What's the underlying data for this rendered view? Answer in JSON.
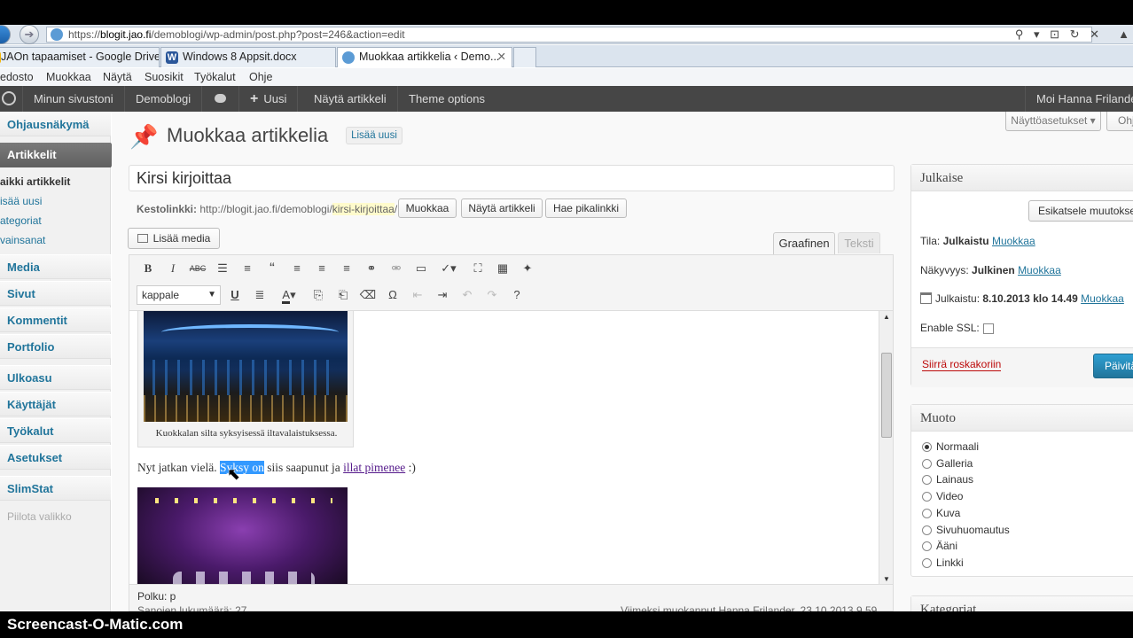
{
  "browser": {
    "url_prefix": "https://",
    "url_host": "blogit.jao.fi",
    "url_path": "/demoblogi/wp-admin/post.php?post=246&action=edit",
    "tabs": [
      {
        "label": "JAOn tapaamiset - Google Drive",
        "icon_color": "#f4b400"
      },
      {
        "label": "Windows 8 Appsit.docx",
        "icon_color": "#2b579a"
      },
      {
        "label": "Muokkaa artikkelia ‹ Demo...",
        "icon_color": "#5b9bd5"
      }
    ],
    "menu": [
      "edosto",
      "Muokkaa",
      "Näytä",
      "Suosikit",
      "Työkalut",
      "Ohje"
    ]
  },
  "adminbar": {
    "items": [
      "Minun sivustoni",
      "Demoblogi",
      "Uusi",
      "Näytä artikkeli",
      "Theme options"
    ],
    "plus": "+",
    "greeting": "Moi Hanna Frilande"
  },
  "sidebar": {
    "dashboard": "Ohjausnäkymä",
    "posts": "Artikkelit",
    "submenu": [
      "Kaikki artikkelit",
      "Lisää uusi",
      "Kategoriat",
      "Avainsanat"
    ],
    "submenu_visible": [
      "aikki artikkelit",
      "isää uusi",
      "ategoriat",
      "vainsanat"
    ],
    "menus": [
      "Media",
      "Sivut",
      "Kommentit",
      "Portfolio",
      "Ulkoasu",
      "Käyttäjät",
      "Työkalut",
      "Asetukset",
      "SlimStat"
    ],
    "collapse": "Piilota valikko"
  },
  "header": {
    "title": "Muokkaa artikkelia",
    "add_new": "Lisää uusi",
    "screen_options": "Näyttöasetukset",
    "help": "Ohje"
  },
  "post": {
    "title": "Kirsi kirjoittaa",
    "permalink_label": "Kestolinkki:",
    "permalink_base": "http://blogit.jao.fi/demoblogi/",
    "permalink_slug": "kirsi-kirjoittaa",
    "permalink_end": "/",
    "edit_btn": "Muokkaa",
    "view_btn": "Näytä artikkeli",
    "shortlink_btn": "Hae pikalinkki",
    "add_media": "Lisää media",
    "tab_visual": "Graafinen",
    "tab_text": "Teksti",
    "format_select": "kappale"
  },
  "content": {
    "caption": "Kuokkalan silta syksyisessä iltavalaistuksessa.",
    "para_start": "Nyt jatkan vielä. ",
    "para_selected": "Syksy on",
    "para_mid": " siis saapunut ja ",
    "para_link": "illat pimenee",
    "para_end": " :)",
    "path": "Polku: p",
    "word_count": "Sanojen lukumäärä: 27",
    "last_edited": "Viimeksi muokannut Hanna Frilander, 23.10.2013 9.59"
  },
  "publish": {
    "heading": "Julkaise",
    "preview": "Esikatsele muutokse",
    "status_label": "Tila:",
    "status_value": "Julkaistu",
    "status_edit": "Muokkaa",
    "visibility_label": "Näkyvyys:",
    "visibility_value": "Julkinen",
    "visibility_edit": "Muokkaa",
    "published_label": "Julkaistu:",
    "published_value": "8.10.2013 klo 14.49",
    "published_edit": "Muokkaa",
    "ssl_label": "Enable SSL:",
    "trash": "Siirrä roskakoriin",
    "update": "Päivitä"
  },
  "format_box": {
    "heading": "Muoto",
    "options": [
      "Normaali",
      "Galleria",
      "Lainaus",
      "Video",
      "Kuva",
      "Sivuhuomautus",
      "Ääni",
      "Linkki"
    ],
    "selected": "Normaali"
  },
  "categories_box": {
    "heading": "Kategoriat"
  },
  "watermark": "Screencast-O-Matic.com",
  "colors": {
    "wp_blue": "#21759b",
    "adminbar": "#464646",
    "selection": "#3399ff",
    "update_btn": "#2a8bbc"
  }
}
